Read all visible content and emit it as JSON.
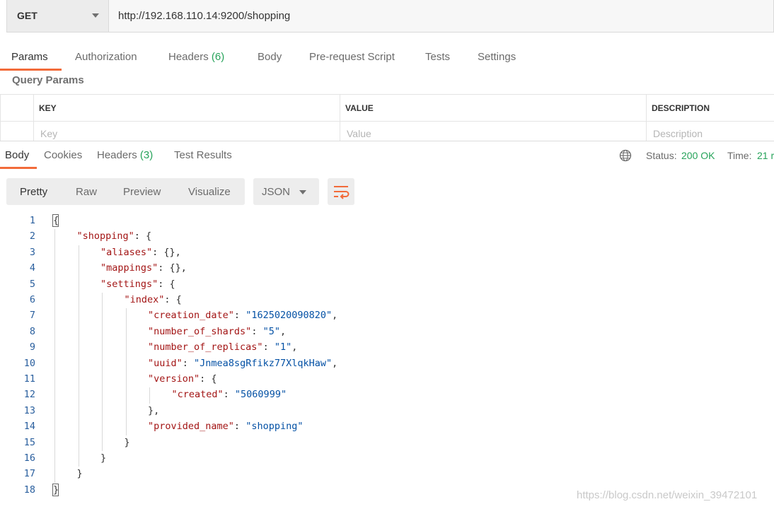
{
  "request": {
    "method": "GET",
    "url": "http://192.168.110.14:9200/shopping"
  },
  "request_tabs": {
    "params": "Params",
    "authorization": "Authorization",
    "headers": "Headers",
    "headers_count": "(6)",
    "body": "Body",
    "prerequest": "Pre-request Script",
    "tests": "Tests",
    "settings": "Settings"
  },
  "query_params": {
    "title": "Query Params",
    "columns": {
      "key": "KEY",
      "value": "VALUE",
      "description": "DESCRIPTION"
    },
    "placeholders": {
      "key": "Key",
      "value": "Value",
      "description": "Description"
    }
  },
  "response_tabs": {
    "body": "Body",
    "cookies": "Cookies",
    "headers": "Headers",
    "headers_count": "(3)",
    "test_results": "Test Results"
  },
  "status": {
    "label": "Status:",
    "value": "200 OK",
    "time_label": "Time:",
    "time_value": "21 r"
  },
  "view": {
    "pretty": "Pretty",
    "raw": "Raw",
    "preview": "Preview",
    "visualize": "Visualize",
    "format": "JSON"
  },
  "colors": {
    "accent": "#f26b3a",
    "success": "#26a35a",
    "key": "#a31515",
    "string": "#0451a5"
  },
  "icons": {
    "method_dropdown": "chevron-down-icon",
    "network": "globe-icon",
    "wrap": "wrap-lines-icon"
  },
  "code_lines": [
    {
      "n": "1",
      "indent": 0,
      "parts": [
        [
          "p",
          "{"
        ]
      ]
    },
    {
      "n": "2",
      "indent": 1,
      "parts": [
        [
          "k",
          "\"shopping\""
        ],
        [
          "p",
          ": {"
        ]
      ]
    },
    {
      "n": "3",
      "indent": 2,
      "parts": [
        [
          "k",
          "\"aliases\""
        ],
        [
          "p",
          ": {},"
        ]
      ]
    },
    {
      "n": "4",
      "indent": 2,
      "parts": [
        [
          "k",
          "\"mappings\""
        ],
        [
          "p",
          ": {},"
        ]
      ]
    },
    {
      "n": "5",
      "indent": 2,
      "parts": [
        [
          "k",
          "\"settings\""
        ],
        [
          "p",
          ": {"
        ]
      ]
    },
    {
      "n": "6",
      "indent": 3,
      "parts": [
        [
          "k",
          "\"index\""
        ],
        [
          "p",
          ": {"
        ]
      ]
    },
    {
      "n": "7",
      "indent": 4,
      "parts": [
        [
          "k",
          "\"creation_date\""
        ],
        [
          "p",
          ": "
        ],
        [
          "s",
          "\"1625020090820\""
        ],
        [
          "p",
          ","
        ]
      ]
    },
    {
      "n": "8",
      "indent": 4,
      "parts": [
        [
          "k",
          "\"number_of_shards\""
        ],
        [
          "p",
          ": "
        ],
        [
          "s",
          "\"5\""
        ],
        [
          "p",
          ","
        ]
      ]
    },
    {
      "n": "9",
      "indent": 4,
      "parts": [
        [
          "k",
          "\"number_of_replicas\""
        ],
        [
          "p",
          ": "
        ],
        [
          "s",
          "\"1\""
        ],
        [
          "p",
          ","
        ]
      ]
    },
    {
      "n": "10",
      "indent": 4,
      "parts": [
        [
          "k",
          "\"uuid\""
        ],
        [
          "p",
          ": "
        ],
        [
          "s",
          "\"Jnmea8sgRfikz77XlqkHaw\""
        ],
        [
          "p",
          ","
        ]
      ]
    },
    {
      "n": "11",
      "indent": 4,
      "parts": [
        [
          "k",
          "\"version\""
        ],
        [
          "p",
          ": {"
        ]
      ]
    },
    {
      "n": "12",
      "indent": 5,
      "parts": [
        [
          "k",
          "\"created\""
        ],
        [
          "p",
          ": "
        ],
        [
          "s",
          "\"5060999\""
        ]
      ]
    },
    {
      "n": "13",
      "indent": 4,
      "parts": [
        [
          "p",
          "},"
        ]
      ]
    },
    {
      "n": "14",
      "indent": 4,
      "parts": [
        [
          "k",
          "\"provided_name\""
        ],
        [
          "p",
          ": "
        ],
        [
          "s",
          "\"shopping\""
        ]
      ]
    },
    {
      "n": "15",
      "indent": 3,
      "parts": [
        [
          "p",
          "}"
        ]
      ]
    },
    {
      "n": "16",
      "indent": 2,
      "parts": [
        [
          "p",
          "}"
        ]
      ]
    },
    {
      "n": "17",
      "indent": 1,
      "parts": [
        [
          "p",
          "}"
        ]
      ]
    },
    {
      "n": "18",
      "indent": 0,
      "parts": [
        [
          "p",
          "}"
        ]
      ]
    }
  ],
  "watermark": "https://blog.csdn.net/weixin_39472101"
}
